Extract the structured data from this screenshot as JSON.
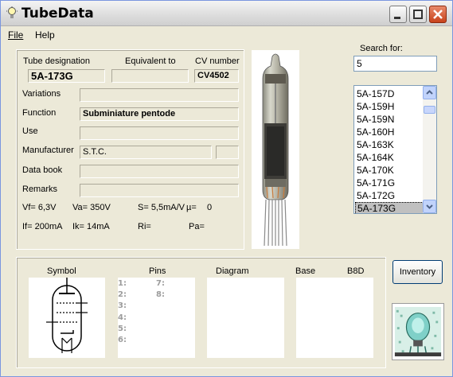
{
  "window": {
    "title": "TubeData",
    "icon": "lightbulb-icon",
    "controls": {
      "minimize": "minimize-icon",
      "maximize": "maximize-icon",
      "close": "close-icon"
    }
  },
  "menu": {
    "file": "File",
    "help": "Help"
  },
  "details": {
    "tube_designation_label": "Tube designation",
    "tube_designation": "5A-173G",
    "equivalent_label": "Equivalent to",
    "equivalent": "",
    "cv_label": "CV number",
    "cv": "CV4502",
    "variations_label": "Variations",
    "variations": "",
    "function_label": "Function",
    "function": "Subminiature pentode",
    "use_label": "Use",
    "use": "",
    "manufacturer_label": "Manufacturer",
    "manufacturer": "S.T.C.",
    "manufacturer_extra": "",
    "databook_label": "Data book",
    "databook": "",
    "remarks_label": "Remarks",
    "remarks": "",
    "vf": "Vf= 6,3V",
    "va": "Va= 350V",
    "s": "S= 5,5mA/V",
    "mu": "µ=",
    "mu_value": "0",
    "if": "If= 200mA",
    "ik": "Ik= 14mA",
    "ri": "Ri=",
    "pa": "Pa="
  },
  "search": {
    "label": "Search for:",
    "value": "5",
    "results": [
      "5A-157D",
      "5A-159H",
      "5A-159N",
      "5A-160H",
      "5A-163K",
      "5A-164K",
      "5A-170K",
      "5A-171G",
      "5A-172G",
      "5A-173G"
    ],
    "selected": "5A-173G"
  },
  "lower": {
    "symbol_label": "Symbol",
    "pins_label": "Pins",
    "diagram_label": "Diagram",
    "base_label": "Base",
    "base_value": "B8D",
    "pins_left": [
      "1:",
      "2:",
      "3:",
      "4:",
      "5:",
      "6:"
    ],
    "pins_right": [
      "7:",
      "8:"
    ],
    "inventory_button": "Inventory"
  }
}
